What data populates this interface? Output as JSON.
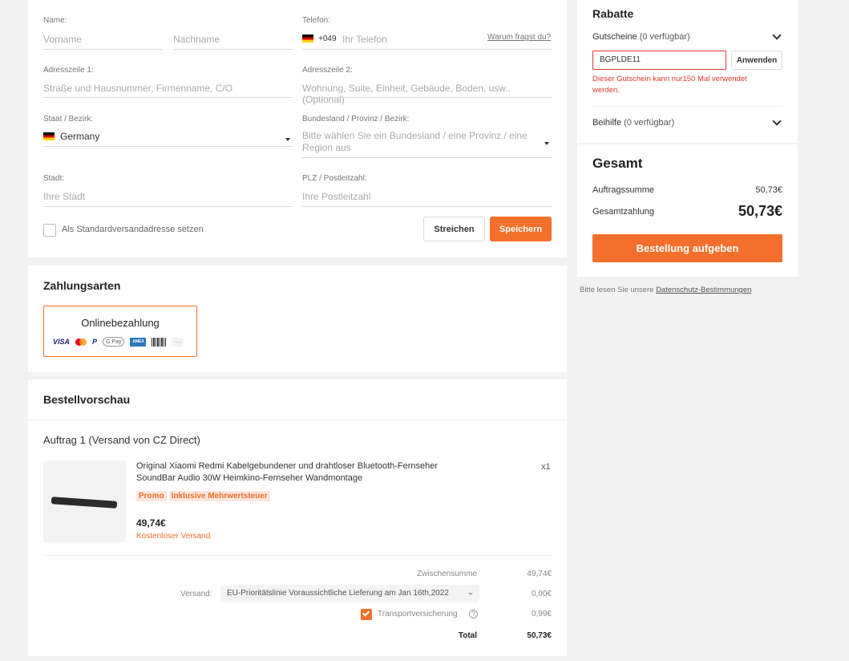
{
  "address": {
    "name_label": "Name:",
    "first_name_placeholder": "Vorname",
    "last_name_placeholder": "Nachname",
    "phone_label": "Telefon:",
    "phone_prefix": "+049",
    "phone_placeholder": "Ihr Telefon",
    "why_ask": "Warum fragst du?",
    "address1_label": "Adresszeile 1:",
    "address1_placeholder": "Straße und Hausnummer, Firmenname, C/O",
    "address2_label": "Adresszeile 2:",
    "address2_placeholder": "Wohnung, Suite, Einheit, Gebäude, Boden, usw.. (Optional)",
    "state_label": "Staat / Bezirk:",
    "state_value": "Germany",
    "province_label": "Bundesland / Provinz / Bezirk:",
    "province_placeholder": "Bitte wählen Sie ein Bundesland / eine Provinz / eine Region aus",
    "city_label": "Stadt:",
    "city_placeholder": "Ihre Stadt",
    "zip_label": "PLZ / Postleitzahl:",
    "zip_placeholder": "Ihre Postleitzahl",
    "default_checkbox_label": "Als Standardversandadresse setzen",
    "cancel_label": "Streichen",
    "save_label": "Speichern"
  },
  "payment": {
    "title": "Zahlungsarten",
    "option_title": "Onlinebezahlung",
    "icons": {
      "visa": "VISA",
      "paypal": "P",
      "gpay": "G Pay",
      "amex": "AMEX",
      "more": "···"
    }
  },
  "preview": {
    "title": "Bestellvorschau",
    "order_title": "Auftrag 1 (Versand von CZ Direct)",
    "product_name": "Original Xiaomi Redmi Kabelgebundener und drahtloser Bluetooth-Fernseher SoundBar Audio 30W Heimkino-Fernseher Wandmontage",
    "quantity": "x1",
    "tag_promo": "Promo",
    "tag_vat": "Inklusive Mehrwertsteuer",
    "price": "49,74€",
    "free_shipping": "Kostenloser Versand",
    "subtotal_label": "Zwischensumme",
    "subtotal_value": "49,74€",
    "shipping_label": "Versand:",
    "shipping_option": "EU-Prioritätslinie Voraussichtliche Lieferung am Jan 16th,2022",
    "shipping_value": "0,00€",
    "insurance_label": "Transportversicherung",
    "insurance_value": "0,99€",
    "total_label": "Total",
    "total_value": "50,73€"
  },
  "discounts": {
    "title": "Rabatte",
    "coupons_label": "Gutscheine",
    "coupons_count": "(0 verfügbar)",
    "coupon_value": "BGPLDE11",
    "apply_label": "Anwenden",
    "coupon_error": "Dieser Gutschein kann nur150 Mal verwendet werden.",
    "allowance_label": "Beihilfe",
    "allowance_count": "(0 verfügbar)"
  },
  "summary": {
    "title": "Gesamt",
    "order_sum_label": "Auftragssumme",
    "order_sum_value": "50,73€",
    "total_payment_label": "Gesamtzahlung",
    "total_payment_value": "50,73€",
    "place_order_label": "Bestellung aufgeben",
    "privacy_prefix": "Bitte lesen Sie unsere",
    "privacy_link": "Datenschutz-Bestimmungen"
  },
  "colors": {
    "accent": "#f46f2b",
    "error": "#e0392b",
    "background": "#f2f2f2"
  }
}
